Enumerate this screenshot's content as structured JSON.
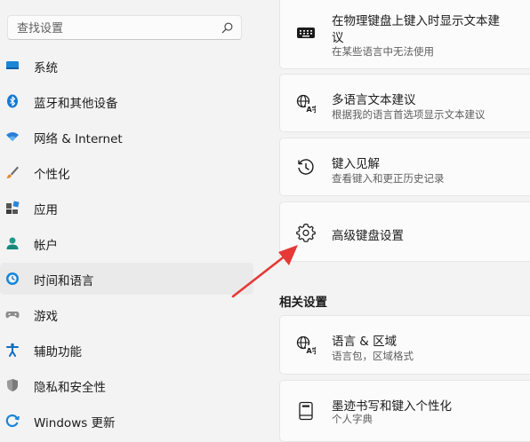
{
  "search": {
    "placeholder": "查找设置"
  },
  "sidebar": {
    "items": [
      {
        "label": "系统",
        "icon": "system-icon"
      },
      {
        "label": "蓝牙和其他设备",
        "icon": "bluetooth-icon"
      },
      {
        "label": "网络 & Internet",
        "icon": "wifi-icon"
      },
      {
        "label": "个性化",
        "icon": "brush-icon"
      },
      {
        "label": "应用",
        "icon": "apps-icon"
      },
      {
        "label": "帐户",
        "icon": "account-icon"
      },
      {
        "label": "时间和语言",
        "icon": "time-language-icon",
        "active": true
      },
      {
        "label": "游戏",
        "icon": "gaming-icon"
      },
      {
        "label": "辅助功能",
        "icon": "accessibility-icon"
      },
      {
        "label": "隐私和安全性",
        "icon": "shield-icon"
      },
      {
        "label": "Windows 更新",
        "icon": "windows-update-icon"
      }
    ]
  },
  "main": {
    "cards": [
      {
        "title_line1": "在物理键盘上键入时显示文本建",
        "title_line2": "议",
        "subtitle": "在某些语言中无法使用",
        "icon": "keyboard-icon"
      },
      {
        "title": "多语言文本建议",
        "subtitle": "根据我的语言首选项显示文本建议",
        "icon": "language-text-icon"
      },
      {
        "title": "键入见解",
        "subtitle": "查看键入和更正历史记录",
        "icon": "history-icon"
      },
      {
        "title": "高级键盘设置",
        "icon": "gear-icon"
      }
    ],
    "related_heading": "相关设置",
    "related": [
      {
        "title": "语言 & 区域",
        "subtitle": "语言包，区域格式",
        "icon": "language-region-icon"
      },
      {
        "title": "墨迹书写和键入个性化",
        "subtitle": "个人字典",
        "icon": "notebook-icon"
      }
    ]
  },
  "colors": {
    "accent": "#0067c0",
    "annotation_arrow": "#e53935"
  }
}
